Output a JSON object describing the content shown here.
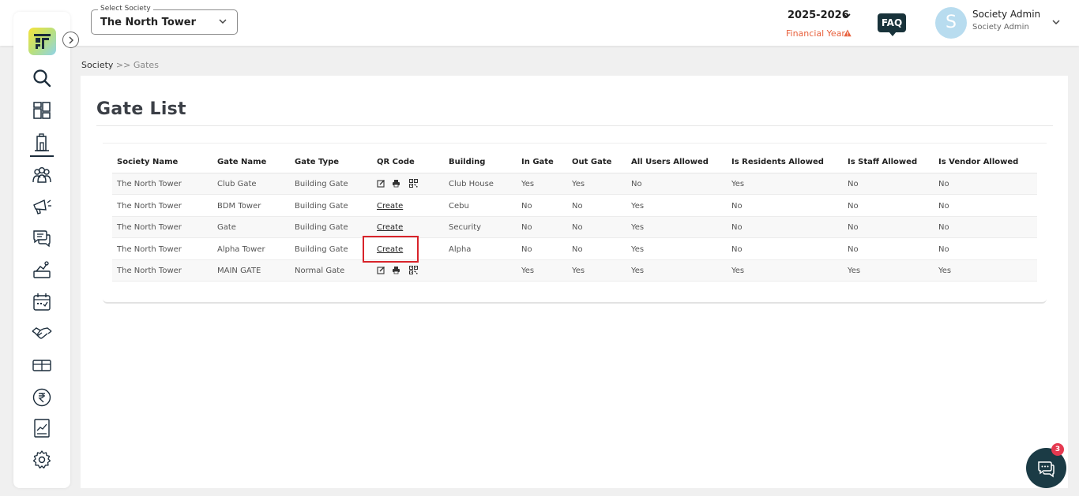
{
  "header": {
    "society_select": {
      "legend": "Select Society",
      "value": "The North Tower"
    },
    "financial_year": {
      "year": "2025-2026",
      "label": "Financial Year"
    },
    "faq_label": "FAQ",
    "user": {
      "initial": "S",
      "name": "Society Admin",
      "role": "Society Admin"
    }
  },
  "sidebar": {
    "items": [
      {
        "icon": "search-icon"
      },
      {
        "icon": "dashboard-grid-icon"
      },
      {
        "icon": "building-icon",
        "active": true
      },
      {
        "icon": "members-icon"
      },
      {
        "icon": "announcement-icon"
      },
      {
        "icon": "chat-bubbles-icon"
      },
      {
        "icon": "complaint-icon"
      },
      {
        "icon": "calendar-icon"
      },
      {
        "icon": "handshake-icon"
      },
      {
        "icon": "amenities-icon"
      },
      {
        "icon": "rupee-icon"
      },
      {
        "icon": "reports-chart-icon"
      },
      {
        "icon": "settings-gear-icon"
      }
    ]
  },
  "breadcrumb": {
    "root": "Society",
    "separator": " >> ",
    "current": "Gates"
  },
  "page": {
    "title": "Gate List"
  },
  "table": {
    "columns": [
      "Society Name",
      "Gate Name",
      "Gate Type",
      "QR Code",
      "Building",
      "In Gate",
      "Out Gate",
      "All Users Allowed",
      "Is Residents Allowed",
      "Is Staff Allowed",
      "Is Vendor Allowed"
    ],
    "rows": [
      {
        "society": "The North Tower",
        "gate": "Club Gate",
        "type": "Building Gate",
        "qr": "icons",
        "building": "Club House",
        "in_gate": "Yes",
        "out_gate": "Yes",
        "all_users": "No",
        "residents": "Yes",
        "staff": "No",
        "vendor": "No"
      },
      {
        "society": "The North Tower",
        "gate": "BDM Tower",
        "type": "Building Gate",
        "qr": "Create",
        "building": "Cebu",
        "in_gate": "No",
        "out_gate": "No",
        "all_users": "Yes",
        "residents": "No",
        "staff": "No",
        "vendor": "No"
      },
      {
        "society": "The North Tower",
        "gate": "Gate",
        "type": "Building Gate",
        "qr": "Create",
        "building": "Security",
        "in_gate": "No",
        "out_gate": "No",
        "all_users": "Yes",
        "residents": "No",
        "staff": "No",
        "vendor": "No"
      },
      {
        "society": "The North Tower",
        "gate": "Alpha Tower",
        "type": "Building Gate",
        "qr": "Create",
        "building": "Alpha",
        "in_gate": "No",
        "out_gate": "No",
        "all_users": "Yes",
        "residents": "No",
        "staff": "No",
        "vendor": "No"
      },
      {
        "society": "The North Tower",
        "gate": "MAIN GATE",
        "type": "Normal Gate",
        "qr": "icons",
        "building": "",
        "in_gate": "Yes",
        "out_gate": "Yes",
        "all_users": "Yes",
        "residents": "Yes",
        "staff": "Yes",
        "vendor": "Yes"
      }
    ]
  },
  "chat": {
    "badge_count": "3"
  },
  "colors": {
    "accent_dark": "#1b3b45",
    "warning": "#e8603c",
    "highlight": "#d8232a",
    "badge": "#e53950"
  }
}
